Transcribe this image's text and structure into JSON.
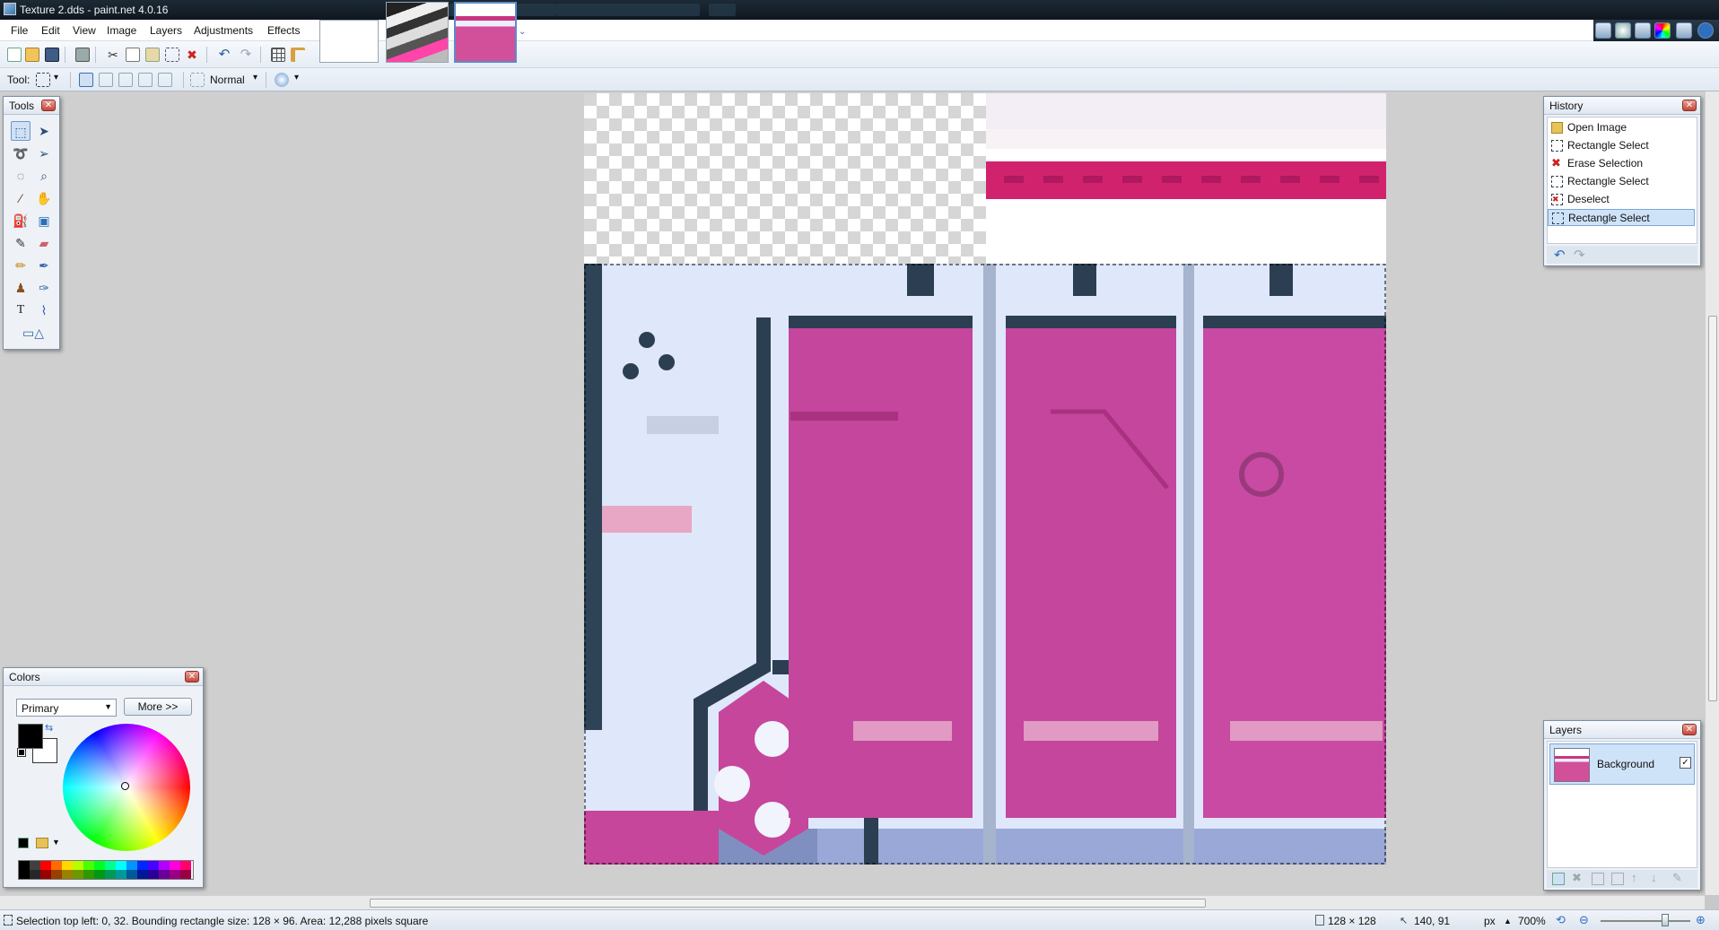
{
  "window": {
    "title": "Texture 2.dds - paint.net 4.0.16"
  },
  "menu": {
    "items": [
      "File",
      "Edit",
      "View",
      "Image",
      "Layers",
      "Adjustments",
      "Effects"
    ]
  },
  "toolbar": {
    "tool_label": "Tool:",
    "blend_mode": "Normal"
  },
  "tools_panel": {
    "title": "Tools",
    "tools": [
      "rectangle-select-icon",
      "move-selection-icon",
      "lasso-select-icon",
      "move-selected-icon",
      "ellipse-select-icon",
      "zoom-icon",
      "magic-wand-icon",
      "pan-icon",
      "paint-bucket-icon",
      "gradient-icon",
      "paintbrush-icon",
      "eraser-icon",
      "pencil-icon",
      "color-picker-icon",
      "clone-stamp-icon",
      "recolor-icon",
      "text-icon",
      "line-curve-icon",
      "shapes-icon"
    ]
  },
  "history_panel": {
    "title": "History",
    "items": [
      {
        "label": "Open Image",
        "icon": "open-image-icon"
      },
      {
        "label": "Rectangle Select",
        "icon": "rectangle-select-icon"
      },
      {
        "label": "Erase Selection",
        "icon": "erase-icon"
      },
      {
        "label": "Rectangle Select",
        "icon": "rectangle-select-icon"
      },
      {
        "label": "Deselect",
        "icon": "deselect-icon"
      },
      {
        "label": "Rectangle Select",
        "icon": "rectangle-select-icon"
      }
    ],
    "selected_index": 5
  },
  "colors_panel": {
    "title": "Colors",
    "mode_select": "Primary",
    "more_button": "More >>",
    "primary_color": "#000000",
    "secondary_color": "#ffffff",
    "palette": [
      "#000000",
      "#404040",
      "#ff0000",
      "#ff6a00",
      "#ffd800",
      "#b6ff00",
      "#4cff00",
      "#00ff21",
      "#00ff90",
      "#00ffff",
      "#0094ff",
      "#0026ff",
      "#4800ff",
      "#b200ff",
      "#ff00dc",
      "#ff006e"
    ]
  },
  "layers_panel": {
    "title": "Layers",
    "layers": [
      {
        "name": "Background",
        "visible": true
      }
    ]
  },
  "status": {
    "selection_info": "Selection top left: 0, 32. Bounding rectangle size: 128 × 96. Area: 12,288 pixels square",
    "image_size": "128 × 128",
    "cursor_pos": "140, 91",
    "units": "px",
    "zoom": "700%"
  },
  "colors": {
    "accent": "#3a6fb0",
    "magenta": "#c0449a",
    "dark_slate": "#2c3e52"
  }
}
